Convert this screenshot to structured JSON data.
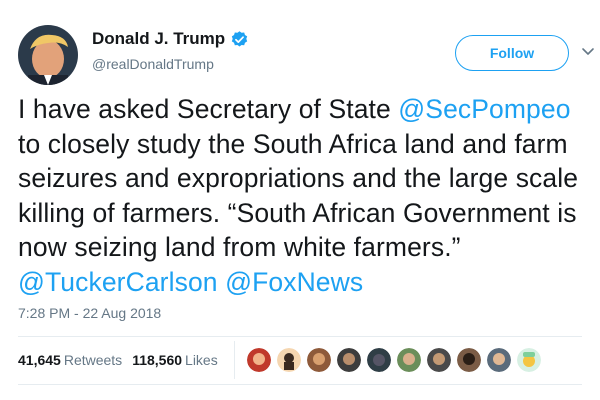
{
  "author": {
    "display_name": "Donald J. Trump",
    "handle": "@realDonaldTrump",
    "verified_icon": "verified-badge-icon"
  },
  "follow_label": "Follow",
  "tweet": {
    "part1": "I have asked Secretary of State ",
    "mention1": "@SecPompeo",
    "part2": " to closely study the South Africa land and farm seizures and expropriations and the large scale killing of farmers. “South African Government is now seizing land from white farmers.” ",
    "mention2": "@TuckerCarlson",
    "part3": " ",
    "mention3": "@FoxNews"
  },
  "timestamp": "7:28 PM - 22 Aug 2018",
  "stats": {
    "retweets_count": "41,645",
    "retweets_label": "Retweets",
    "likes_count": "118,560",
    "likes_label": "Likes"
  },
  "colors": {
    "accent": "#1da1f2",
    "text": "#14171a",
    "muted": "#657786"
  }
}
